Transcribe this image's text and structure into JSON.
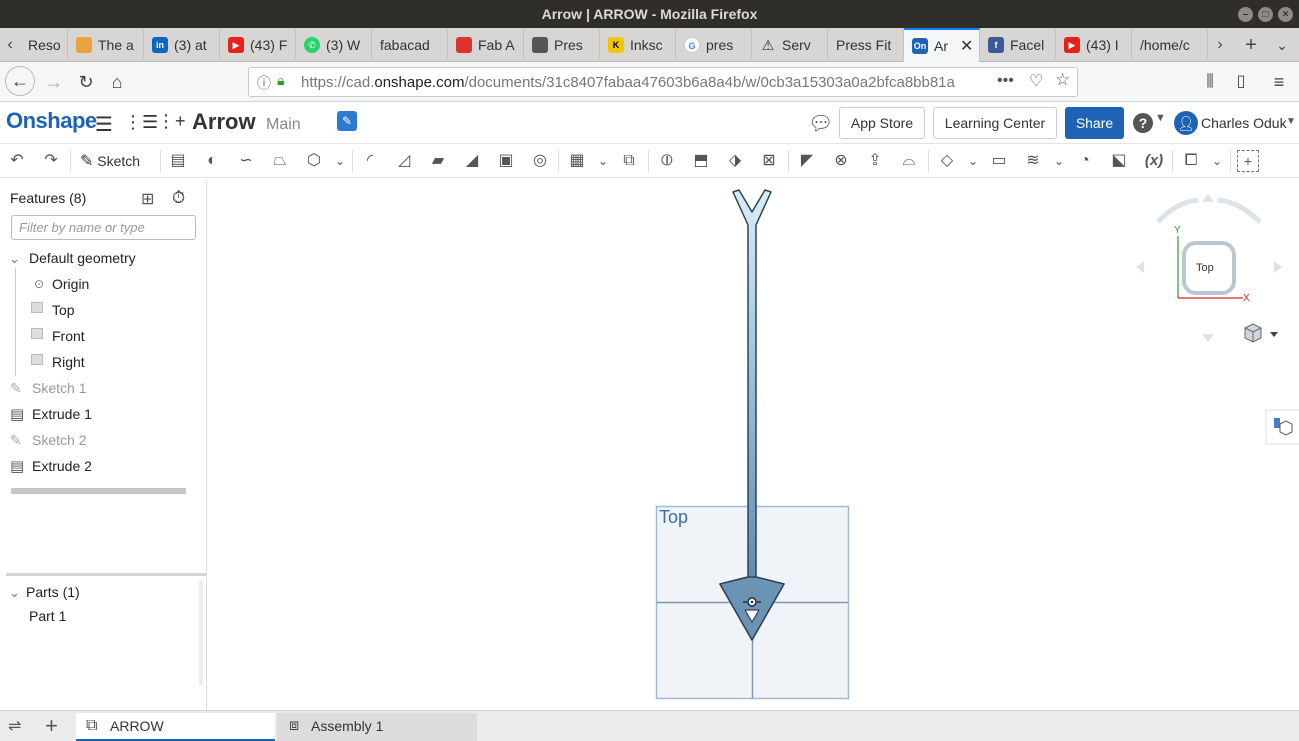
{
  "window": {
    "title": "Arrow | ARROW - Mozilla Firefox"
  },
  "tabs": [
    {
      "label": "Reso",
      "icon": "hash-icon"
    },
    {
      "label": "The a",
      "icon": "cube-icon"
    },
    {
      "label": "(3) at",
      "icon": "linkedin-icon"
    },
    {
      "label": "(43) F",
      "icon": "youtube-icon"
    },
    {
      "label": "(3) W",
      "icon": "whatsapp-icon"
    },
    {
      "label": "fabacad",
      "icon": ""
    },
    {
      "label": "Fab A",
      "icon": "fab-icon"
    },
    {
      "label": "Pres",
      "icon": "scale-icon"
    },
    {
      "label": "Inksc",
      "icon": "inkscape-icon"
    },
    {
      "label": "pres",
      "icon": "google-icon"
    },
    {
      "label": "Serv",
      "icon": "warning-icon"
    },
    {
      "label": "Press Fit",
      "icon": ""
    },
    {
      "label": "Ar",
      "icon": "onshape-icon",
      "active": true
    },
    {
      "label": "Facel",
      "icon": "facebook-icon"
    },
    {
      "label": "(43) I",
      "icon": "youtube-icon"
    },
    {
      "label": "/home/c",
      "icon": ""
    }
  ],
  "nav": {
    "url_prefix": "https://cad.",
    "url_domain": "onshape.com",
    "url_rest": "/documents/31c8407fabaa47603b6a8a4b/w/0cb3a15303a0a2bfca8bb81a"
  },
  "app": {
    "logo": "Onshape",
    "doc_title": "Arrow",
    "branch": "Main",
    "app_store": "App Store",
    "learning_center": "Learning Center",
    "share": "Share",
    "user": "Charles Oduk"
  },
  "toolbar": {
    "sketch_label": "Sketch",
    "variable_label": "(x)"
  },
  "features": {
    "header": "Features (8)",
    "filter_placeholder": "Filter by name or type",
    "default_geometry": "Default geometry",
    "origin": "Origin",
    "top": "Top",
    "front": "Front",
    "right": "Right",
    "sketch1": "Sketch 1",
    "extrude1": "Extrude 1",
    "sketch2": "Sketch 2",
    "extrude2": "Extrude 2"
  },
  "parts": {
    "header": "Parts (1)",
    "part1": "Part 1"
  },
  "viewport": {
    "plane_label": "Top",
    "viewcube_face": "Top",
    "axis_x": "X",
    "axis_y": "Y"
  },
  "bottom": {
    "tab1": "ARROW",
    "tab2": "Assembly 1"
  }
}
